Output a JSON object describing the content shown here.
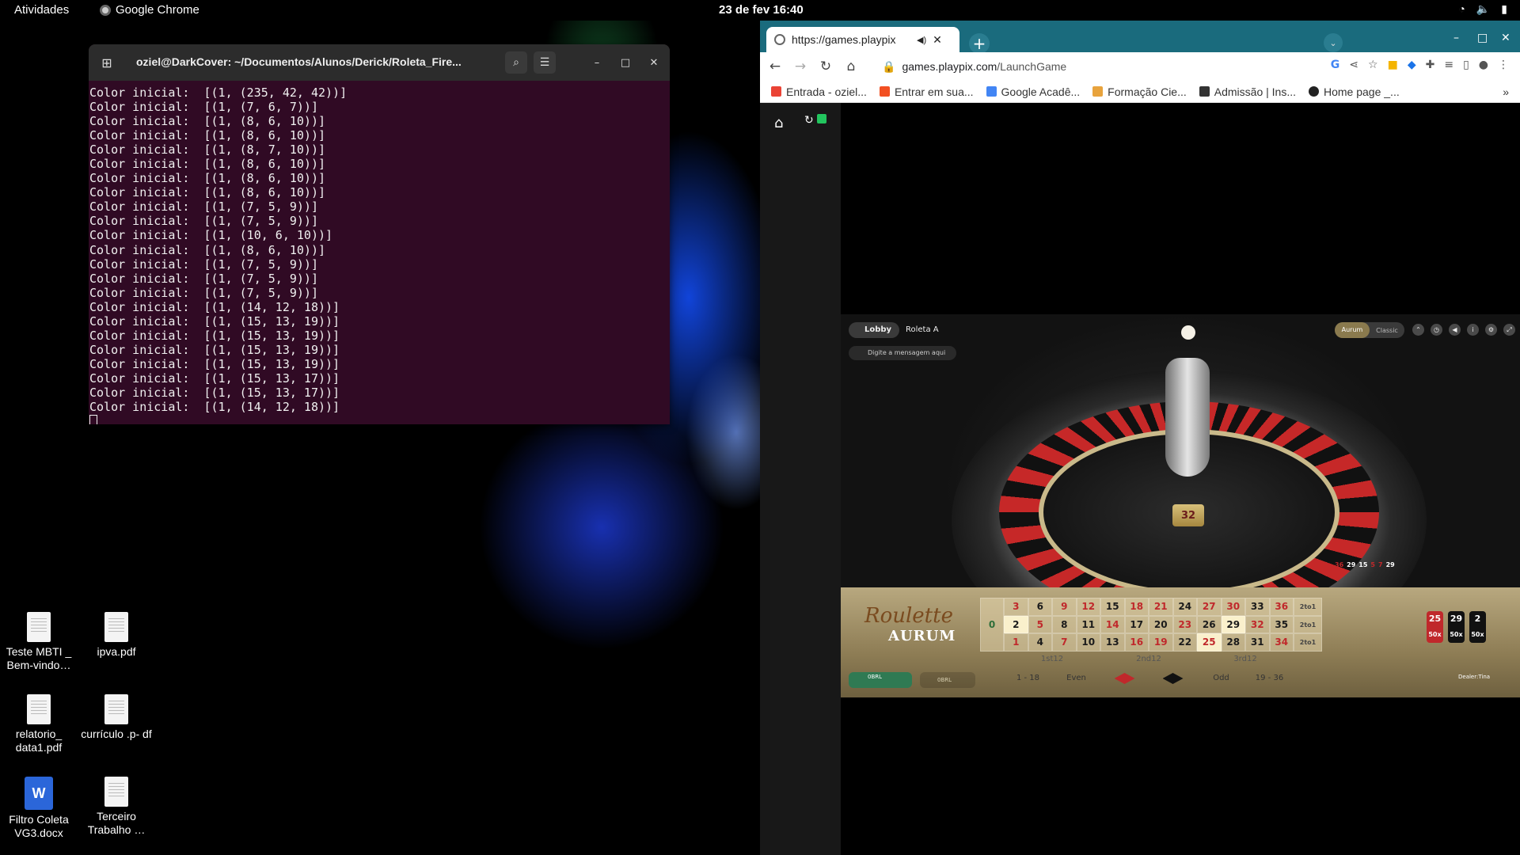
{
  "topbar": {
    "activities": "Atividades",
    "app": "Google Chrome",
    "clock": "23 de fev  16:40",
    "tray": [
      "wifi-icon",
      "volume-icon",
      "power-icon"
    ]
  },
  "terminal": {
    "title": "oziel@DarkCover: ~/Documentos/Alunos/Derick/Roleta_Fire...",
    "lines": [
      "Color inicial:  [(1, (235, 42, 42))]",
      "Color inicial:  [(1, (7, 6, 7))]",
      "Color inicial:  [(1, (8, 6, 10))]",
      "Color inicial:  [(1, (8, 6, 10))]",
      "Color inicial:  [(1, (8, 7, 10))]",
      "Color inicial:  [(1, (8, 6, 10))]",
      "Color inicial:  [(1, (8, 6, 10))]",
      "Color inicial:  [(1, (8, 6, 10))]",
      "Color inicial:  [(1, (7, 5, 9))]",
      "Color inicial:  [(1, (7, 5, 9))]",
      "Color inicial:  [(1, (10, 6, 10))]",
      "Color inicial:  [(1, (8, 6, 10))]",
      "Color inicial:  [(1, (7, 5, 9))]",
      "Color inicial:  [(1, (7, 5, 9))]",
      "Color inicial:  [(1, (7, 5, 9))]",
      "Color inicial:  [(1, (14, 12, 18))]",
      "Color inicial:  [(1, (15, 13, 19))]",
      "Color inicial:  [(1, (15, 13, 19))]",
      "Color inicial:  [(1, (15, 13, 19))]",
      "Color inicial:  [(1, (15, 13, 19))]",
      "Color inicial:  [(1, (15, 13, 17))]",
      "Color inicial:  [(1, (15, 13, 17))]",
      "Color inicial:  [(1, (14, 12, 18))]"
    ]
  },
  "desktop": {
    "icons": [
      {
        "label": "Teste MBTI _ Bem-vindo…",
        "kind": "doc"
      },
      {
        "label": "ipva.pdf",
        "kind": "doc"
      },
      {
        "label": "relatorio_ data1.pdf",
        "kind": "doc"
      },
      {
        "label": "currículo .p- df",
        "kind": "doc"
      },
      {
        "label": "Filtro Coleta VG3.docx",
        "kind": "word"
      },
      {
        "label": "Terceiro Trabalho …",
        "kind": "doc"
      }
    ]
  },
  "chrome": {
    "tab_title": "https://games.playpix",
    "url_host": "games.playpix.com",
    "url_path": "/LaunchGame",
    "bookmarks": [
      {
        "label": "Entrada - oziel...",
        "color": "#ea4335"
      },
      {
        "label": "Entrar em sua...",
        "color": "#f25022"
      },
      {
        "label": "Google Acadê...",
        "color": "#4285f4"
      },
      {
        "label": "Formação Cie...",
        "color": "#e8a33d"
      },
      {
        "label": "Admissão | Ins...",
        "color": "#333333"
      },
      {
        "label": "Home page _...",
        "color": "#222222"
      }
    ],
    "more_bookmarks": "»"
  },
  "game": {
    "lobby": "Lobby",
    "table_name": "Roleta A",
    "chat_placeholder": "Digite a mensagem aqui",
    "mode_on": "Aurum",
    "mode_off": "Classic",
    "result": "32",
    "history": [
      {
        "n": "36",
        "c": "#c0282b"
      },
      {
        "n": "29",
        "c": "#ffffff"
      },
      {
        "n": "15",
        "c": "#ffffff"
      },
      {
        "n": "5",
        "c": "#c0282b"
      },
      {
        "n": "7",
        "c": "#c0282b"
      },
      {
        "n": "29",
        "c": "#ffffff"
      }
    ],
    "logo_line1": "Roulette",
    "logo_line2": "AURUM",
    "table": {
      "zero": "0",
      "rows": [
        [
          {
            "n": "3",
            "c": "red"
          },
          {
            "n": "6",
            "c": "blk"
          },
          {
            "n": "9",
            "c": "red"
          },
          {
            "n": "12",
            "c": "red"
          },
          {
            "n": "15",
            "c": "blk"
          },
          {
            "n": "18",
            "c": "red"
          },
          {
            "n": "21",
            "c": "red"
          },
          {
            "n": "24",
            "c": "blk"
          },
          {
            "n": "27",
            "c": "red"
          },
          {
            "n": "30",
            "c": "red"
          },
          {
            "n": "33",
            "c": "blk"
          },
          {
            "n": "36",
            "c": "red"
          }
        ],
        [
          {
            "n": "2",
            "c": "blk",
            "hl": true
          },
          {
            "n": "5",
            "c": "red"
          },
          {
            "n": "8",
            "c": "blk"
          },
          {
            "n": "11",
            "c": "blk"
          },
          {
            "n": "14",
            "c": "red"
          },
          {
            "n": "17",
            "c": "blk"
          },
          {
            "n": "20",
            "c": "blk"
          },
          {
            "n": "23",
            "c": "red"
          },
          {
            "n": "26",
            "c": "blk"
          },
          {
            "n": "29",
            "c": "blk",
            "hl": true
          },
          {
            "n": "32",
            "c": "red"
          },
          {
            "n": "35",
            "c": "blk"
          }
        ],
        [
          {
            "n": "1",
            "c": "red"
          },
          {
            "n": "4",
            "c": "blk"
          },
          {
            "n": "7",
            "c": "red"
          },
          {
            "n": "10",
            "c": "blk"
          },
          {
            "n": "13",
            "c": "blk"
          },
          {
            "n": "16",
            "c": "red"
          },
          {
            "n": "19",
            "c": "red"
          },
          {
            "n": "22",
            "c": "blk"
          },
          {
            "n": "25",
            "c": "red",
            "hl": true
          },
          {
            "n": "28",
            "c": "blk"
          },
          {
            "n": "31",
            "c": "blk"
          },
          {
            "n": "34",
            "c": "red"
          }
        ]
      ],
      "column_bet": "2to1",
      "dozens": [
        "1st12",
        "2nd12",
        "3rd12"
      ],
      "outside": [
        "1 - 18",
        "Even",
        "red-diamond",
        "black-diamond",
        "Odd",
        "19 - 36"
      ]
    },
    "balance_label": "0BRL",
    "balance2_label": "0BRL",
    "lucky_chips": [
      {
        "n": "25",
        "m": "50x",
        "color": "#c0282b"
      },
      {
        "n": "29",
        "m": "50x",
        "color": "#111111"
      },
      {
        "n": "2",
        "m": "50x",
        "color": "#111111"
      }
    ],
    "dealer": "Dealer:Tina"
  }
}
